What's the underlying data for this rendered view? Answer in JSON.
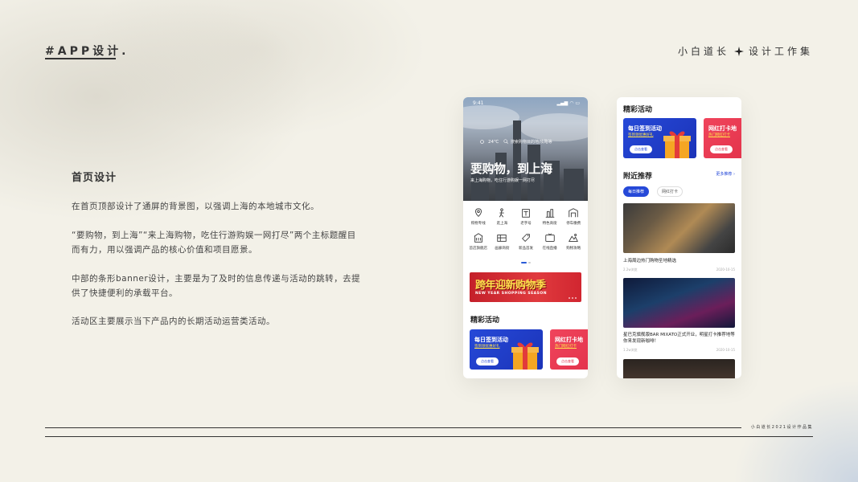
{
  "header": {
    "logo": "#APP设计.",
    "brand_left": "小白道长",
    "brand_right": "设计工作集"
  },
  "intro": {
    "title": "首页设计",
    "paragraphs": [
      "在首页顶部设计了通屏的背景图，以强调上海的本地城市文化。",
      "“要购物，到上海”“来上海购物，吃住行游购娱一网打尽”两个主标题醒目而有力，用以强调产品的核心价值和项目愿景。",
      "中部的条形banner设计，主要是为了及时的信息传递与活动的跳转，去提供了快捷便利的承载平台。",
      "活动区主要展示当下产品内的长期活动运营类活动。"
    ]
  },
  "footer": {
    "text": "小白道长2021设计作品集"
  },
  "phone1": {
    "time": "9:41",
    "weather": "24℃",
    "search_placeholder": "搜索购物目的地/攻略等",
    "hero_title": "要购物，到上海",
    "hero_sub": "来上海购物，吃住行游购娱一网打尽",
    "grid": [
      {
        "label": "购物专线",
        "icon": "map-pin-icon"
      },
      {
        "label": "逛上海",
        "icon": "walker-icon"
      },
      {
        "label": "老字号",
        "icon": "shop-sign-icon"
      },
      {
        "label": "特色商街",
        "icon": "building-icon"
      },
      {
        "label": "停车缴费",
        "icon": "car-park-icon"
      },
      {
        "label": "首店旗舰店",
        "icon": "store-icon"
      },
      {
        "label": "画廊商街",
        "icon": "gallery-icon"
      },
      {
        "label": "新品首发",
        "icon": "tag-icon"
      },
      {
        "label": "在线直播",
        "icon": "live-tv-icon"
      },
      {
        "label": "购物攻略",
        "icon": "guide-icon"
      }
    ],
    "banner_title": "跨年迎新购物季",
    "banner_sub": "NEW YEAR SHOPPING SEASON",
    "section_title": "精彩活动",
    "card1_title": "每日签到活动",
    "card1_sub": "签到领优惠好礼",
    "card1_btn": "点击查看",
    "card2_title": "网红打卡地",
    "card2_sub": "热门网红打卡",
    "card2_btn": "点击查看"
  },
  "phone2": {
    "section1_title": "精彩活动",
    "card1_title": "每日签到活动",
    "card1_sub": "签到领优惠好礼",
    "card1_btn": "点击查看",
    "card2_title": "网红打卡地",
    "card2_sub": "热门网红打卡",
    "card2_btn": "点击查看",
    "section2_title": "附近推荐",
    "more": "更多推荐 ›",
    "chip_active": "每日推荐",
    "chip_normal": "网红打卡",
    "article1_title": "上海周边热门购物圣地精选",
    "article1_views": "2.2w浏览",
    "article1_date": "2020-10-15",
    "article2_title": "星巴克旗舰版BAR MIXATO正式开业，明星打卡推荐地等你来发现新咖啡！",
    "article2_views": "1.2w浏览",
    "article2_date": "2020-10-15"
  },
  "colors": {
    "accent": "#2649d8",
    "red": "#e2324a",
    "bg": "#f3f1e8"
  }
}
